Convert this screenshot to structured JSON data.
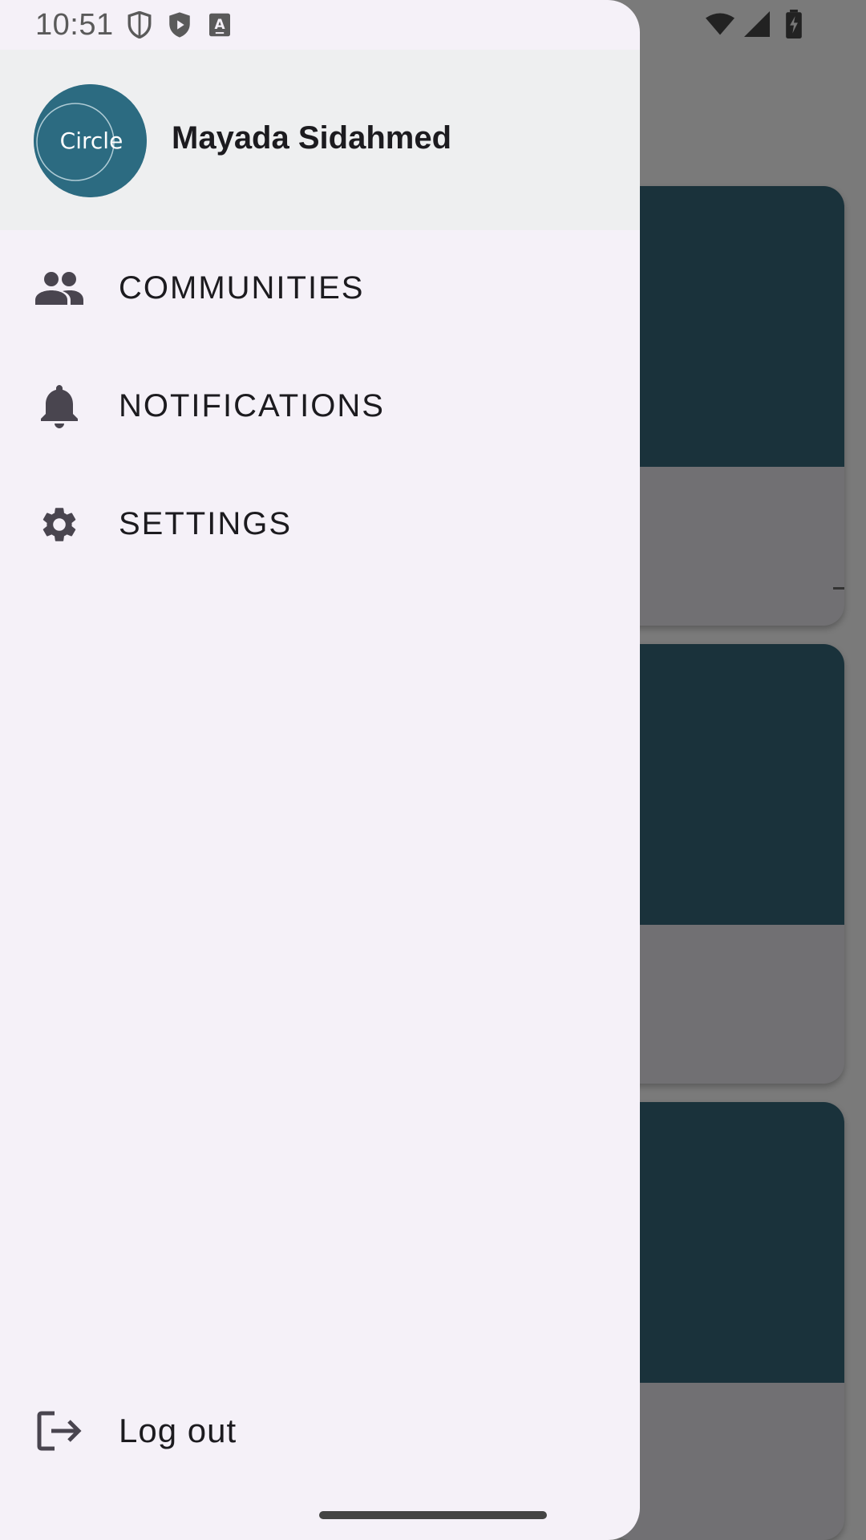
{
  "status_bar": {
    "time": "10:51",
    "left_icons": [
      "shield-outline-icon",
      "play-shield-icon",
      "keyboard-a-icon"
    ],
    "right_icons": [
      "wifi-icon",
      "cell-signal-icon",
      "battery-charging-icon"
    ]
  },
  "drawer": {
    "header": {
      "avatar_text": "Circle",
      "user_name": "Mayada Sidahmed"
    },
    "menu": [
      {
        "label": "COMMUNITIES",
        "icon": "people-icon"
      },
      {
        "label": "NOTIFICATIONS",
        "icon": "bell-icon"
      },
      {
        "label": "SETTINGS",
        "icon": "gear-icon"
      }
    ],
    "logout": {
      "label": "Log out",
      "icon": "logout-icon"
    }
  },
  "colors": {
    "drawer_bg": "#f5f1f8",
    "header_bg": "#eeeff0",
    "avatar_bg": "#2c6b81",
    "card_image": "#1a323b",
    "scrim": "#777777",
    "icon": "#49454f"
  }
}
